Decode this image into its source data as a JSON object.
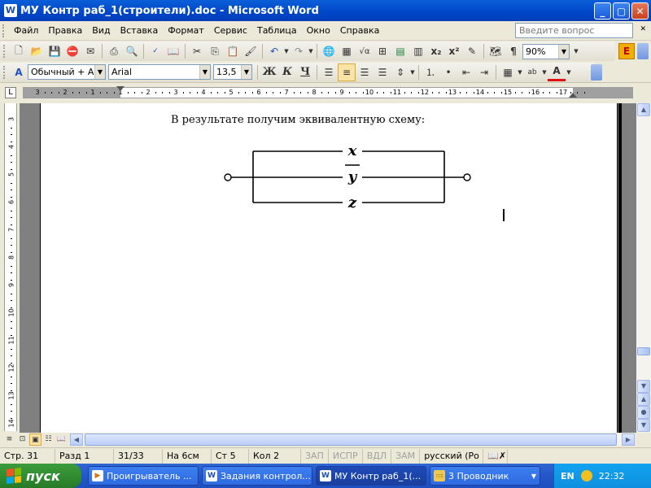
{
  "window": {
    "app_icon": "W",
    "title": "МУ Контр раб_1(строители).doc - Microsoft Word",
    "buttons": {
      "minimize": "_",
      "maximize": "▢",
      "close": "✕"
    }
  },
  "menu": {
    "items": [
      "Файл",
      "Правка",
      "Вид",
      "Вставка",
      "Формат",
      "Сервис",
      "Таблица",
      "Окно",
      "Справка"
    ],
    "help_placeholder": "Введите вопрос"
  },
  "toolbar_standard": {
    "icons": [
      "new-icon",
      "open-icon",
      "save-icon",
      "permission-icon",
      "email-icon",
      "print-icon",
      "print-preview-icon",
      "spelling-icon",
      "research-icon",
      "cut-icon",
      "copy-icon",
      "paste-icon",
      "format-painter-icon",
      "undo-icon",
      "redo-icon",
      "hyperlink-icon",
      "tables-borders-icon",
      "equation-icon",
      "insert-table-icon",
      "insert-excel-icon",
      "columns-icon",
      "subscript-icon",
      "superscript-icon",
      "drawing-icon",
      "document-map-icon",
      "show-formatting-icon"
    ],
    "subscript_label": "x₂",
    "superscript_label": "x²",
    "show_formatting_label": "¶",
    "zoom": "90%",
    "extra_button": "E"
  },
  "toolbar_formatting": {
    "style": "Обычный + Aria",
    "font": "Arial",
    "size": "13,5",
    "bold": "Ж",
    "italic": "К",
    "underline": "Ч",
    "alignment_active": "center",
    "font_color": "#e01010",
    "highlight_color": "#ffff00"
  },
  "ruler": {
    "top_labels": [
      "3",
      "2",
      "1",
      "1",
      "2",
      "3",
      "4",
      "5",
      "6",
      "7",
      "8",
      "9",
      "10",
      "11",
      "12",
      "13",
      "14",
      "15",
      "16",
      "17"
    ],
    "side_labels": [
      "3",
      "4",
      "5",
      "6",
      "7",
      "8",
      "9",
      "10",
      "11",
      "12",
      "13",
      "14"
    ]
  },
  "document": {
    "paragraph": "В результате получим эквивалентную схему:",
    "circuit": {
      "branch_labels": [
        "x",
        "y",
        "z"
      ],
      "middle_overline": true
    }
  },
  "status": {
    "page": "Стр. 31",
    "section": "Разд 1",
    "pages": "31/33",
    "at": "На 6см",
    "line": "Ст 5",
    "column": "Кол 2",
    "rec": "ЗАП",
    "trk": "ИСПР",
    "ext": "ВДЛ",
    "ovr": "ЗАМ",
    "language": "русский (Ро"
  },
  "taskbar": {
    "start": "пуск",
    "tasks": [
      {
        "label": "Проигрыватель ...",
        "icon": "media-player-icon"
      },
      {
        "label": "Задания контрол...",
        "icon": "word-doc-icon"
      },
      {
        "label": "МУ Контр раб_1(...",
        "icon": "word-doc-icon",
        "active": true
      },
      {
        "label": "3 Проводник",
        "icon": "folder-icon"
      }
    ],
    "lang": "EN",
    "time": "22:32"
  }
}
